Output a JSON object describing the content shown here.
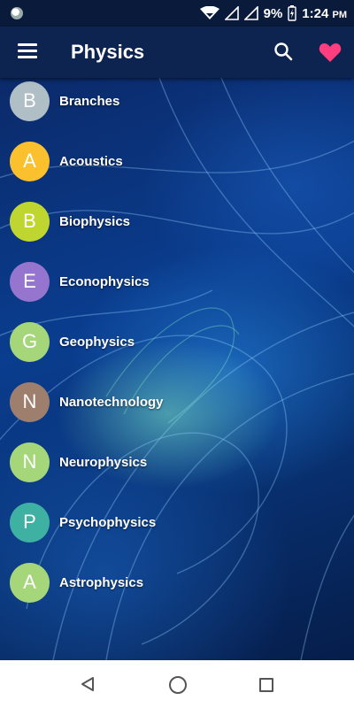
{
  "status_bar": {
    "battery": "9%",
    "time": "1:24",
    "ampm": "PM"
  },
  "app_bar": {
    "title": "Physics",
    "icons": [
      "menu-icon",
      "search-icon",
      "heart-icon"
    ],
    "heart_color": "#ff3d7f"
  },
  "items": [
    {
      "letter": "B",
      "label": "Branches",
      "color": "#b0bec5"
    },
    {
      "letter": "A",
      "label": "Acoustics",
      "color": "#fbc02d"
    },
    {
      "letter": "B",
      "label": "Biophysics",
      "color": "#c0d630"
    },
    {
      "letter": "E",
      "label": "Econophysics",
      "color": "#9575cd"
    },
    {
      "letter": "G",
      "label": "Geophysics",
      "color": "#a5d67a"
    },
    {
      "letter": "N",
      "label": "Nanotechnology",
      "color": "#9e7f6e"
    },
    {
      "letter": "N",
      "label": "Neurophysics",
      "color": "#a5d67a"
    },
    {
      "letter": "P",
      "label": "Psychophysics",
      "color": "#3fb1a3"
    },
    {
      "letter": "A",
      "label": "Astrophysics",
      "color": "#a5d67a"
    }
  ],
  "nav_bar": {
    "icons": [
      "back-icon",
      "home-icon",
      "recent-apps-icon"
    ]
  }
}
